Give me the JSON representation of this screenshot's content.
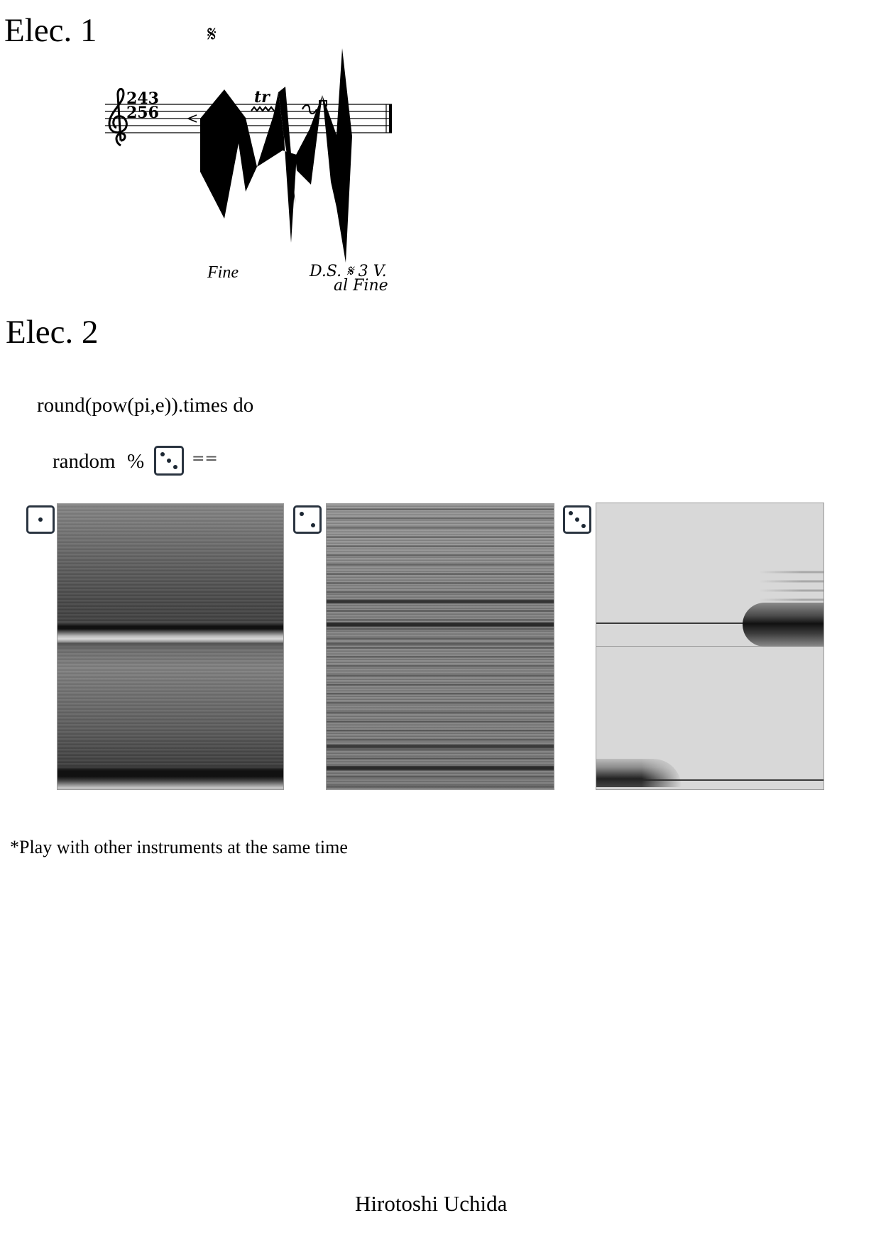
{
  "sections": {
    "elec1_title": "Elec. 1",
    "elec2_title": "Elec. 2"
  },
  "score": {
    "segno": "𝄋",
    "time_signature_numerator": "243",
    "time_signature_denominator": "256",
    "trill_label": "tr",
    "fine_label": "Fine",
    "ds_line1": "D.S. 𝄋 3 V.",
    "ds_line2": "al Fine"
  },
  "code": {
    "loop_line": "round(pow(pi,e)).times do",
    "random_label": "random",
    "modulo": "%",
    "equals": "=="
  },
  "dice": {
    "condition_face": 3,
    "panel_faces": [
      1,
      2,
      3
    ]
  },
  "note": "*Play with other instruments at the same time",
  "composer": "Hirotoshi Uchida",
  "colors": {
    "die_border": "#2a3440",
    "spectro_light": "#d8d8d8",
    "spectro_dark": "#2e2e2e"
  }
}
